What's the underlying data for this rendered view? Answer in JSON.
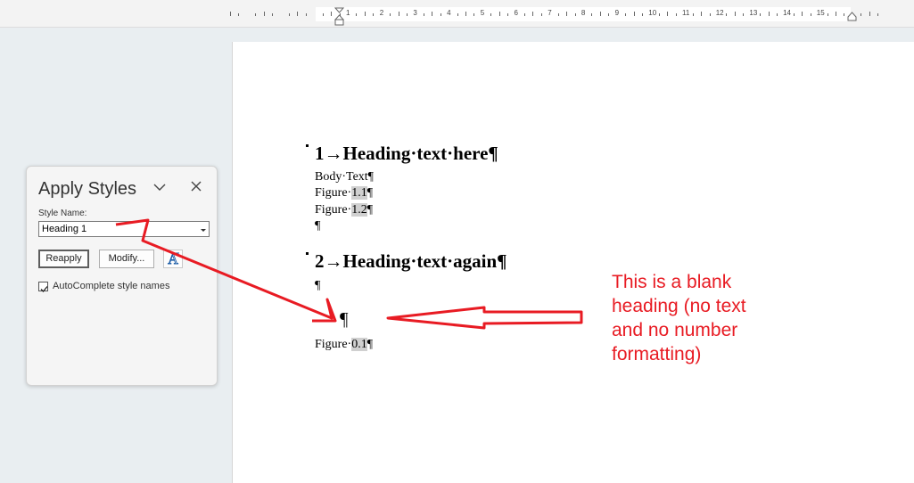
{
  "ruler": {
    "labels": [
      "1",
      "2",
      "3",
      "4",
      "5",
      "6",
      "7",
      "8",
      "9",
      "10",
      "11",
      "12",
      "13",
      "14",
      "15"
    ]
  },
  "document": {
    "heading1": "1→Heading·text·here¶",
    "body_text": "Body·Text¶",
    "figure1_prefix": "Figure·",
    "figure1_num": "1.1",
    "figure2_prefix": "Figure·",
    "figure2_num": "1.2",
    "figure_suffix": "¶",
    "empty_para_1": "¶",
    "heading2": "2→Heading·text·again¶",
    "empty_para_2": "¶",
    "blank_heading": "¶",
    "figure3_prefix": "Figure·",
    "figure3_num": "0.1"
  },
  "apply_styles": {
    "title": "Apply Styles",
    "style_name_label": "Style Name:",
    "style_name_value": "Heading 1",
    "reapply_label": "Reapply",
    "modify_label": "Modify...",
    "autocomplete_label": "AutoComplete style names",
    "autocomplete_checked": true,
    "icons": [
      "chevron-down-icon",
      "close-icon",
      "dropdown-arrow-icon",
      "styles-pane-icon",
      "checkmark-icon"
    ]
  },
  "annotation": {
    "lines": [
      "This is a blank",
      "heading (no text",
      "and no number",
      "formatting)"
    ],
    "color": "#e81b23"
  }
}
